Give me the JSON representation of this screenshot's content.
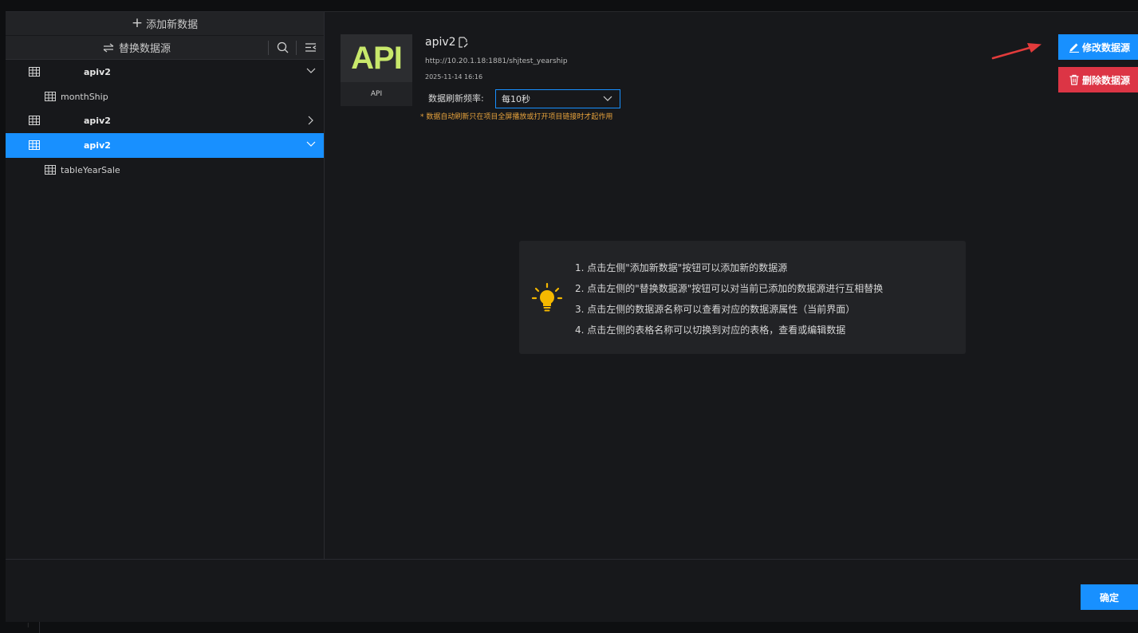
{
  "left_panel": {
    "add_label": "添加新数据",
    "replace_label": "替换数据源",
    "tree": [
      {
        "name": "apiv2",
        "expanded": true,
        "selected": false,
        "children": [
          "monthShip"
        ]
      },
      {
        "name": "apiv2",
        "expanded": false,
        "selected": false,
        "children": []
      },
      {
        "name": "apiv2",
        "expanded": true,
        "selected": true,
        "children": [
          "tableYearSale"
        ]
      }
    ]
  },
  "datasource": {
    "logo_text": "API",
    "type_label": "API",
    "name": "apiv2",
    "url": "http://10.20.1.18:1881/shjtest_yearship",
    "time": "2025-11-14 16:16",
    "refresh_label": "数据刷新频率:",
    "refresh_value": "每10秒",
    "refresh_note": "* 数据自动刷新只在项目全屏播放或打开项目链接时才起作用"
  },
  "actions": {
    "edit_label": "修改数据源",
    "delete_label": "删除数据源"
  },
  "tips": [
    "1. 点击左侧\"添加新数据\"按钮可以添加新的数据源",
    "2. 点击左侧的\"替换数据源\"按钮可以对当前已添加的数据源进行互相替换",
    "3. 点击左侧的数据源名称可以查看对应的数据源属性（当前界面）",
    "4. 点击左侧的表格名称可以切换到对应的表格，查看或编辑数据"
  ],
  "footer": {
    "ok_label": "确定"
  },
  "colors": {
    "primary": "#1890ff",
    "danger": "#dc3545",
    "warning": "#e6a23c",
    "api_logo": "#c8e86b",
    "bulb": "#f5b800"
  }
}
